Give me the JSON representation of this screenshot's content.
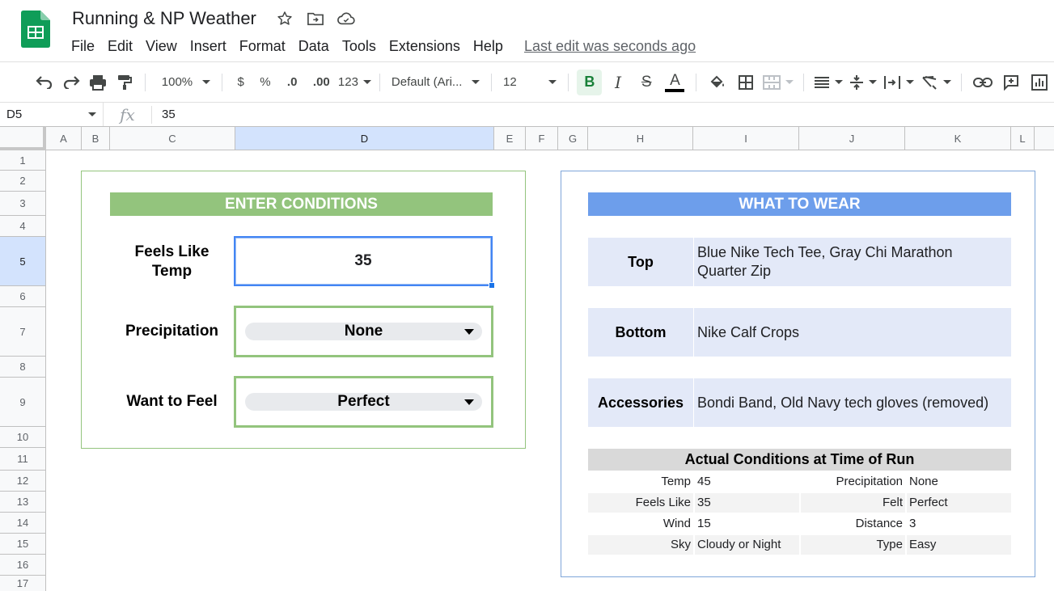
{
  "app": {
    "doc_title": "Running & NP Weather",
    "last_edit": "Last edit was seconds ago",
    "colors": {
      "green": "#93c47d",
      "blue": "#6d9eeb",
      "sheets_green": "#0f9d58"
    }
  },
  "menu": [
    "File",
    "Edit",
    "View",
    "Insert",
    "Format",
    "Data",
    "Tools",
    "Extensions",
    "Help"
  ],
  "toolbar": {
    "zoom": "100%",
    "currency": "$",
    "percent": "%",
    "dec_decrease": ".0",
    "dec_increase": ".00",
    "more_formats": "123",
    "font": "Default (Ari...",
    "font_size": "12",
    "bold": "B",
    "italic": "I",
    "strike": "S",
    "text_color": "A"
  },
  "formula_bar": {
    "cell_ref": "D5",
    "fx": "fx",
    "value": "35"
  },
  "columns": [
    "A",
    "B",
    "C",
    "D",
    "E",
    "F",
    "G",
    "H",
    "I",
    "J",
    "K",
    "L"
  ],
  "rows": [
    "1",
    "2",
    "3",
    "4",
    "5",
    "6",
    "7",
    "8",
    "9",
    "10",
    "11",
    "12",
    "13",
    "14",
    "15",
    "16",
    "17"
  ],
  "enter": {
    "title": "ENTER CONDITIONS",
    "feels_like_label": "Feels Like\nTemp",
    "feels_like_value": "35",
    "precip_label": "Precipitation",
    "precip_value": "None",
    "feel_label": "Want to Feel",
    "feel_value": "Perfect"
  },
  "wear": {
    "title": "WHAT TO WEAR",
    "top_label": "Top",
    "top_value": "Blue Nike Tech Tee, Gray Chi Marathon Quarter Zip",
    "bottom_label": "Bottom",
    "bottom_value": "Nike Calf Crops",
    "acc_label": "Accessories",
    "acc_value": "Bondi Band, Old Navy tech gloves (removed)"
  },
  "actual": {
    "title": "Actual Conditions at Time of Run",
    "rows": [
      {
        "l1": "Temp",
        "v1": "45",
        "l2": "Precipitation",
        "v2": "None"
      },
      {
        "l1": "Feels Like",
        "v1": "35",
        "l2": "Felt",
        "v2": "Perfect"
      },
      {
        "l1": "Wind",
        "v1": "15",
        "l2": "Distance",
        "v2": "3"
      },
      {
        "l1": "Sky",
        "v1": "Cloudy or Night",
        "l2": "Type",
        "v2": "Easy"
      }
    ]
  }
}
